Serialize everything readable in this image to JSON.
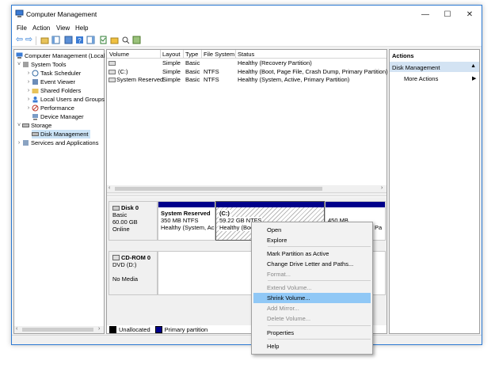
{
  "window": {
    "title": "Computer Management"
  },
  "titlebar_buttons": {
    "minimize": "—",
    "maximize": "☐",
    "close": "✕"
  },
  "menu": [
    "File",
    "Action",
    "View",
    "Help"
  ],
  "tree": {
    "root": "Computer Management (Local",
    "system_tools": "System Tools",
    "task_scheduler": "Task Scheduler",
    "event_viewer": "Event Viewer",
    "shared_folders": "Shared Folders",
    "local_users": "Local Users and Groups",
    "performance": "Performance",
    "device_manager": "Device Manager",
    "storage": "Storage",
    "disk_management": "Disk Management",
    "services": "Services and Applications"
  },
  "volumes": {
    "headers": [
      "Volume",
      "Layout",
      "Type",
      "File System",
      "Status"
    ],
    "rows": [
      {
        "volume": "",
        "layout": "Simple",
        "type": "Basic",
        "fs": "",
        "status": "Healthy (Recovery Partition)"
      },
      {
        "volume": "(C:)",
        "layout": "Simple",
        "type": "Basic",
        "fs": "NTFS",
        "status": "Healthy (Boot, Page File, Crash Dump, Primary Partition)"
      },
      {
        "volume": "System Reserved",
        "layout": "Simple",
        "type": "Basic",
        "fs": "NTFS",
        "status": "Healthy (System, Active, Primary Partition)"
      }
    ]
  },
  "disk0": {
    "name": "Disk 0",
    "type": "Basic",
    "size": "60.00 GB",
    "state": "Online",
    "partitions": {
      "sysres": {
        "name": "System Reserved",
        "size": "350 MB NTFS",
        "status": "Healthy (System, Ac"
      },
      "c": {
        "name": "(C:)",
        "size": "59.22 GB NTFS",
        "status": "Healthy (Boo"
      },
      "recovery": {
        "size": "450 MB",
        "status": "Pa"
      }
    }
  },
  "cdrom": {
    "name": "CD-ROM 0",
    "type": "DVD (D:)",
    "media": "No Media"
  },
  "legend": {
    "unallocated": "Unallocated",
    "primary": "Primary partition"
  },
  "actions": {
    "header": "Actions",
    "section": "Disk Management",
    "more": "More Actions"
  },
  "context_menu": {
    "open": "Open",
    "explore": "Explore",
    "mark_active": "Mark Partition as Active",
    "change_letter": "Change Drive Letter and Paths...",
    "format": "Format...",
    "extend": "Extend Volume...",
    "shrink": "Shrink Volume...",
    "add_mirror": "Add Mirror...",
    "delete": "Delete Volume...",
    "properties": "Properties",
    "help": "Help"
  },
  "colors": {
    "primary_partition": "#00008b",
    "selection": "#90c8f6",
    "accent": "#2b79d3"
  }
}
